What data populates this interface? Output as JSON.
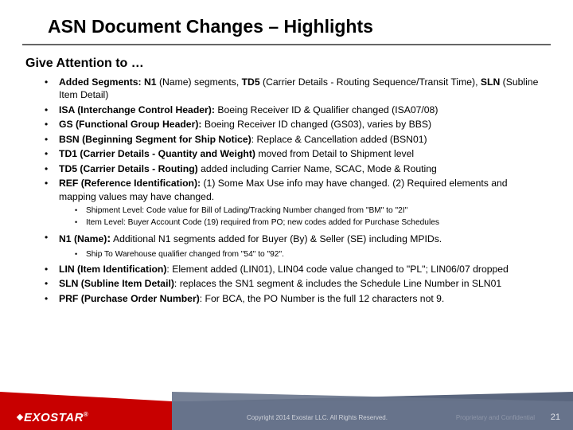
{
  "title": "ASN Document Changes – Highlights",
  "subtitle": "Give Attention to …",
  "bullets": {
    "b1_lead": "Added Segments: N1",
    "b1_mid": " (Name) segments, ",
    "b1_lead2": "TD5",
    "b1_rest": " (Carrier Details - Routing Sequence/Transit Time), ",
    "b1_lead3": "SLN",
    "b1_end": " (Subline Item Detail)",
    "b2_lead": "ISA (Interchange Control Header):",
    "b2_rest": " Boeing Receiver ID & Qualifier changed (ISA07/08)",
    "b3_lead": "GS (Functional Group Header):",
    "b3_rest": " Boeing Receiver ID changed (GS03), varies by BBS)",
    "b4_lead": "BSN (Beginning Segment for Ship Notice)",
    "b4_rest": ": Replace & Cancellation added (BSN01)",
    "b5_lead": "TD1 (Carrier Details - Quantity and Weight)",
    "b5_rest": " moved from Detail to Shipment level",
    "b6_lead": "TD5  (Carrier Details - Routing)",
    "b6_rest": " added including Carrier Name, SCAC, Mode & Routing",
    "b7_lead": "REF (Reference Identification):",
    "b7_rest": " (1) Some Max Use info may have changed. (2) Required elements and mapping values may have changed.",
    "b7_s1": "Shipment Level:  Code value for Bill of Lading/Tracking Number changed from \"BM\" to \"2I\"",
    "b7_s2": "Item Level:  Buyer Account Code (19) required from PO; new codes added for Purchase Schedules",
    "b8_lead": "N1 (Name)",
    "b8_colon": ":",
    "b8_rest": "   Additional N1 segments added for Buyer (By) & Seller (SE) including MPIDs.",
    "b8_s1": "Ship To Warehouse qualifier changed from \"54\" to \"92\".",
    "b9_lead": "LIN (Item Identification)",
    "b9_rest": ":  Element added (LIN01), LIN04 code value changed to \"PL\"; LIN06/07 dropped",
    "b10_lead": "SLN (Subline Item Detail)",
    "b10_rest": ":  replaces the SN1 segment & includes the Schedule Line Number in SLN01",
    "b11_lead": "PRF (Purchase Order Number)",
    "b11_rest": ": For BCA, the PO Number is the full 12 characters not 9."
  },
  "footer": {
    "logo": "EXOSTAR",
    "reg": "®",
    "copyright": "Copyright 2014 Exostar LLC. All Rights Reserved.",
    "stamp": "Proprietary and Confidential",
    "page": "21"
  }
}
